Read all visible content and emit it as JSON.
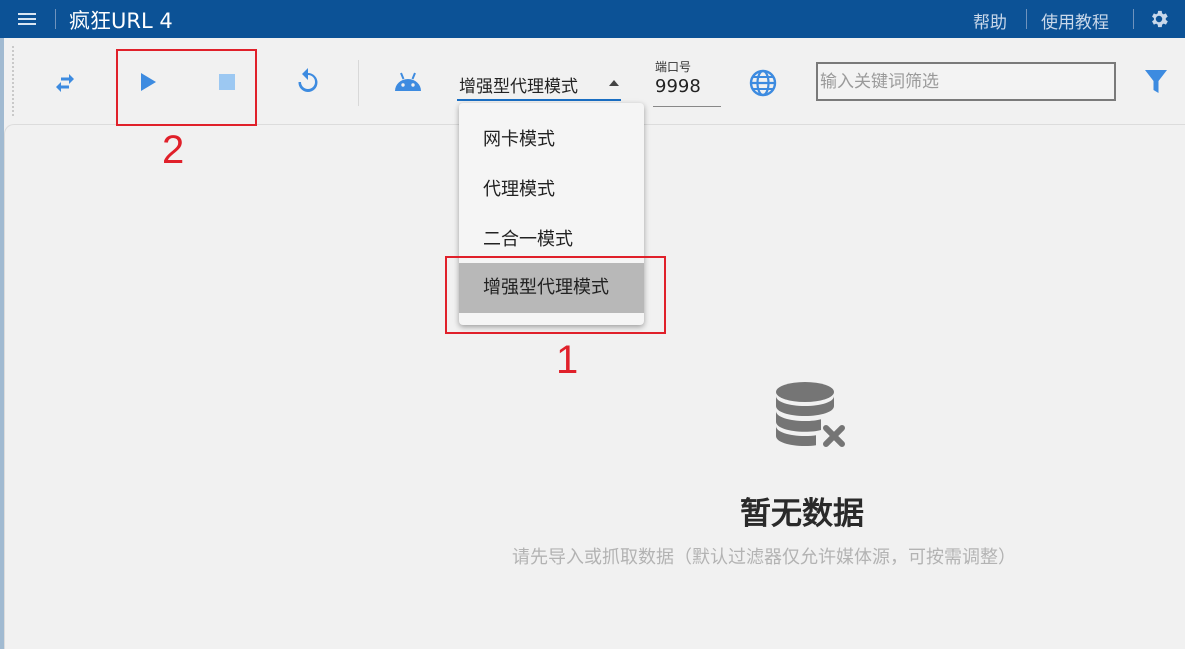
{
  "titlebar": {
    "app_title": "疯狂URL 4",
    "help_label": "帮助",
    "tutorial_label": "使用教程"
  },
  "toolbar": {
    "mode_select_value": "增强型代理模式",
    "port_label": "端口号",
    "port_value": "9998",
    "search_placeholder": "输入关键词筛选"
  },
  "dropdown": {
    "options": [
      "网卡模式",
      "代理模式",
      "二合一模式",
      "增强型代理模式"
    ],
    "selected_index": 3
  },
  "empty_state": {
    "title": "暂无数据",
    "subtitle": "请先导入或抓取数据（默认过滤器仅允许媒体源，可按需调整）"
  },
  "annotations": {
    "label_1": "1",
    "label_2": "2"
  },
  "icons": [
    "menu-icon",
    "swap-icon",
    "play-icon",
    "stop-icon",
    "refresh-icon",
    "android-icon",
    "globe-icon",
    "filter-icon",
    "gear-icon",
    "database-remove-icon"
  ],
  "colors": {
    "titlebar_bg": "#0c5296",
    "accent_blue": "#1a6fc4",
    "icon_blue": "#3d8be0",
    "annotation_red": "#e0202a"
  }
}
